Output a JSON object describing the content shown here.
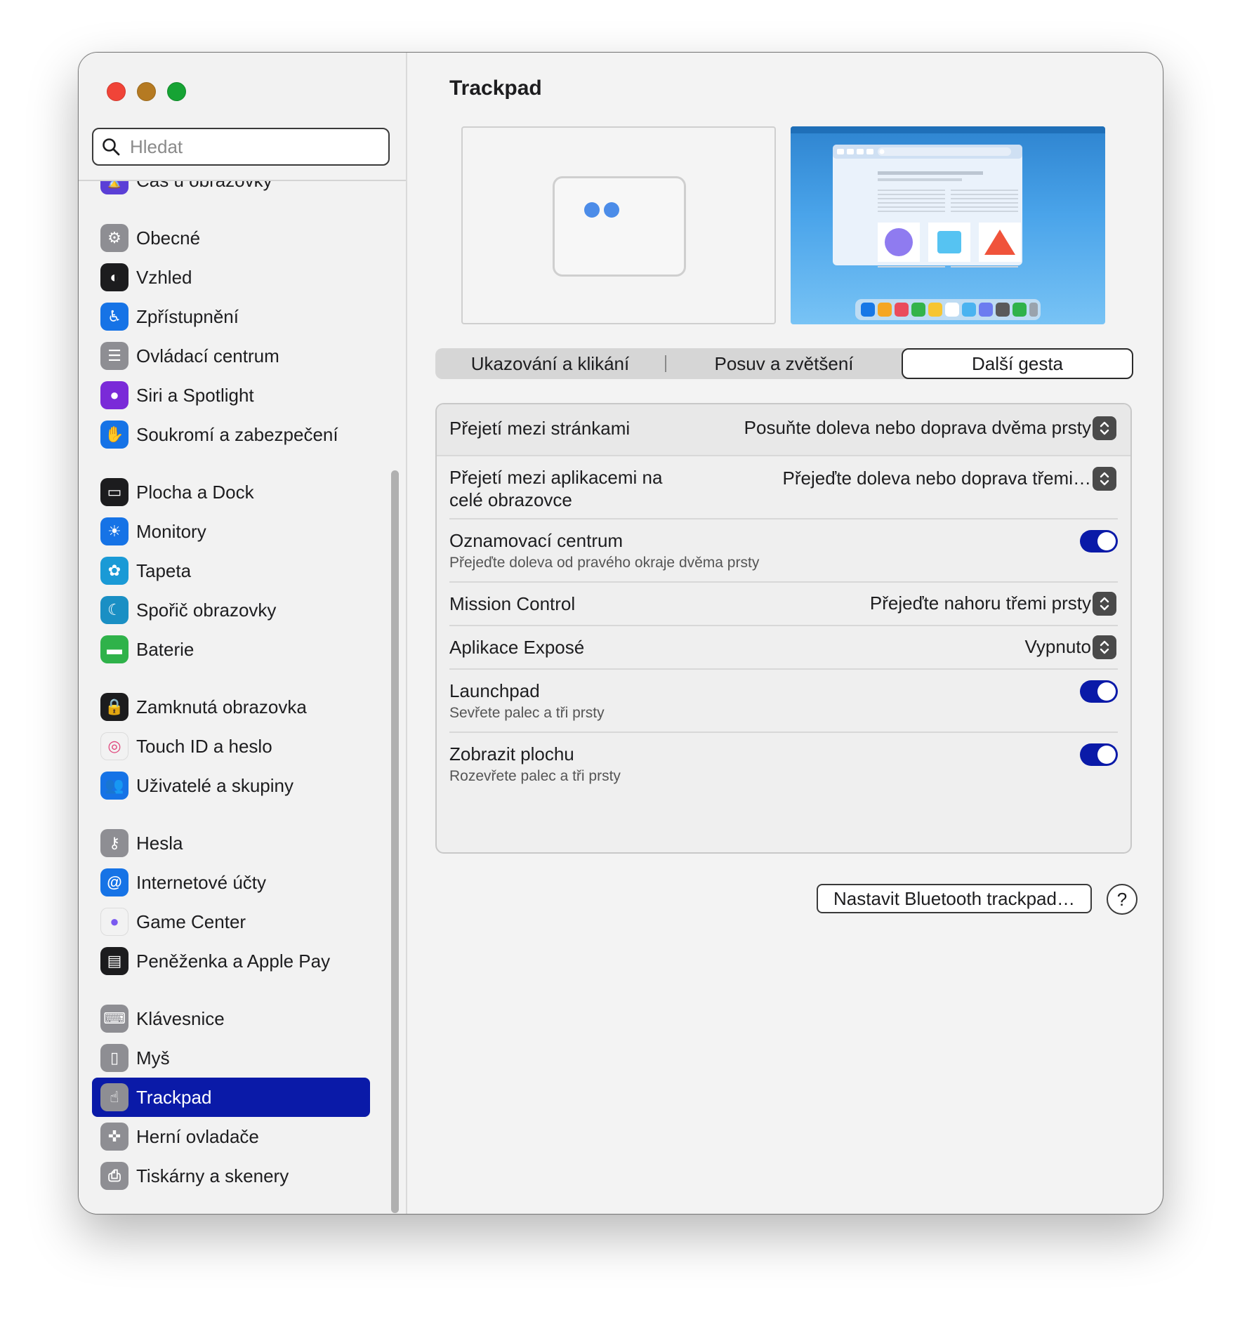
{
  "window": {
    "title": "Trackpad"
  },
  "search": {
    "placeholder": "Hledat"
  },
  "sidebar": {
    "items": [
      {
        "label": "Čas u obrazovky",
        "icon": "hourglass-icon",
        "color": "#5b3fd6",
        "group": 0
      },
      {
        "label": "Obecné",
        "icon": "gear-icon",
        "color": "#8e8e93",
        "group": 1
      },
      {
        "label": "Vzhled",
        "icon": "appearance-icon",
        "color": "#1c1c1e",
        "group": 1
      },
      {
        "label": "Zpřístupnění",
        "icon": "accessibility-icon",
        "color": "#1673e6",
        "group": 1
      },
      {
        "label": "Ovládací centrum",
        "icon": "control-center-icon",
        "color": "#8e8e93",
        "group": 1
      },
      {
        "label": "Siri a Spotlight",
        "icon": "siri-icon",
        "color": "#7a2ad8",
        "group": 1
      },
      {
        "label": "Soukromí a zabezpečení",
        "icon": "hand-icon",
        "color": "#1673e6",
        "group": 1
      },
      {
        "label": "Plocha a Dock",
        "icon": "dock-icon",
        "color": "#1c1c1e",
        "group": 2
      },
      {
        "label": "Monitory",
        "icon": "sun-icon",
        "color": "#1673e6",
        "group": 2
      },
      {
        "label": "Tapeta",
        "icon": "flower-icon",
        "color": "#1a9ad6",
        "group": 2
      },
      {
        "label": "Spořič obrazovky",
        "icon": "screensaver-icon",
        "color": "#1a8fc4",
        "group": 2
      },
      {
        "label": "Baterie",
        "icon": "battery-icon",
        "color": "#2fb24a",
        "group": 2
      },
      {
        "label": "Zamknutá obrazovka",
        "icon": "lock-icon",
        "color": "#1c1c1e",
        "group": 3
      },
      {
        "label": "Touch ID a heslo",
        "icon": "fingerprint-icon",
        "color": "#f2f2f2",
        "group": 3
      },
      {
        "label": "Uživatelé a skupiny",
        "icon": "users-icon",
        "color": "#1673e6",
        "group": 3
      },
      {
        "label": "Hesla",
        "icon": "key-icon",
        "color": "#8e8e93",
        "group": 4
      },
      {
        "label": "Internetové účty",
        "icon": "at-icon",
        "color": "#1673e6",
        "group": 4
      },
      {
        "label": "Game Center",
        "icon": "game-center-icon",
        "color": "#f2f2f2",
        "group": 4
      },
      {
        "label": "Peněženka a Apple Pay",
        "icon": "wallet-icon",
        "color": "#1c1c1e",
        "group": 4
      },
      {
        "label": "Klávesnice",
        "icon": "keyboard-icon",
        "color": "#8e8e93",
        "group": 5
      },
      {
        "label": "Myš",
        "icon": "mouse-icon",
        "color": "#8e8e93",
        "group": 5
      },
      {
        "label": "Trackpad",
        "icon": "trackpad-icon",
        "color": "#8e8e93",
        "group": 5,
        "active": true
      },
      {
        "label": "Herní ovladače",
        "icon": "gamepad-icon",
        "color": "#8e8e93",
        "group": 5
      },
      {
        "label": "Tiskárny a skenery",
        "icon": "printer-icon",
        "color": "#8e8e93",
        "group": 5
      }
    ]
  },
  "tabs": [
    {
      "label": "Ukazování a klikání",
      "active": false
    },
    {
      "label": "Posuv a zvětšení",
      "active": false
    },
    {
      "label": "Další gesta",
      "active": true
    }
  ],
  "settings": {
    "swipe_pages": {
      "label": "Přejetí mezi stránkami",
      "value": "Posuňte doleva nebo doprava dvěma prsty"
    },
    "swipe_apps": {
      "label_line1": "Přejetí mezi aplikacemi na",
      "label_line2": "celé obrazovce",
      "value": "Přejeďte doleva nebo doprava třemi…"
    },
    "notification_center": {
      "label": "Oznamovací centrum",
      "sub": "Přejeďte doleva od pravého okraje dvěma prsty",
      "enabled": true
    },
    "mission_control": {
      "label": "Mission Control",
      "value": "Přejeďte nahoru třemi prsty"
    },
    "app_expose": {
      "label": "Aplikace Exposé",
      "value": "Vypnuto"
    },
    "launchpad": {
      "label": "Launchpad",
      "sub": "Sevřete palec a tři prsty",
      "enabled": true
    },
    "show_desktop": {
      "label": "Zobrazit plochu",
      "sub": "Rozevřete palec a tři prsty",
      "enabled": true
    }
  },
  "buttons": {
    "bluetooth": "Nastavit Bluetooth trackpad…",
    "help": "?"
  },
  "colors": {
    "accent": "#0a1aa8",
    "window_bg": "#f3f3f3"
  }
}
